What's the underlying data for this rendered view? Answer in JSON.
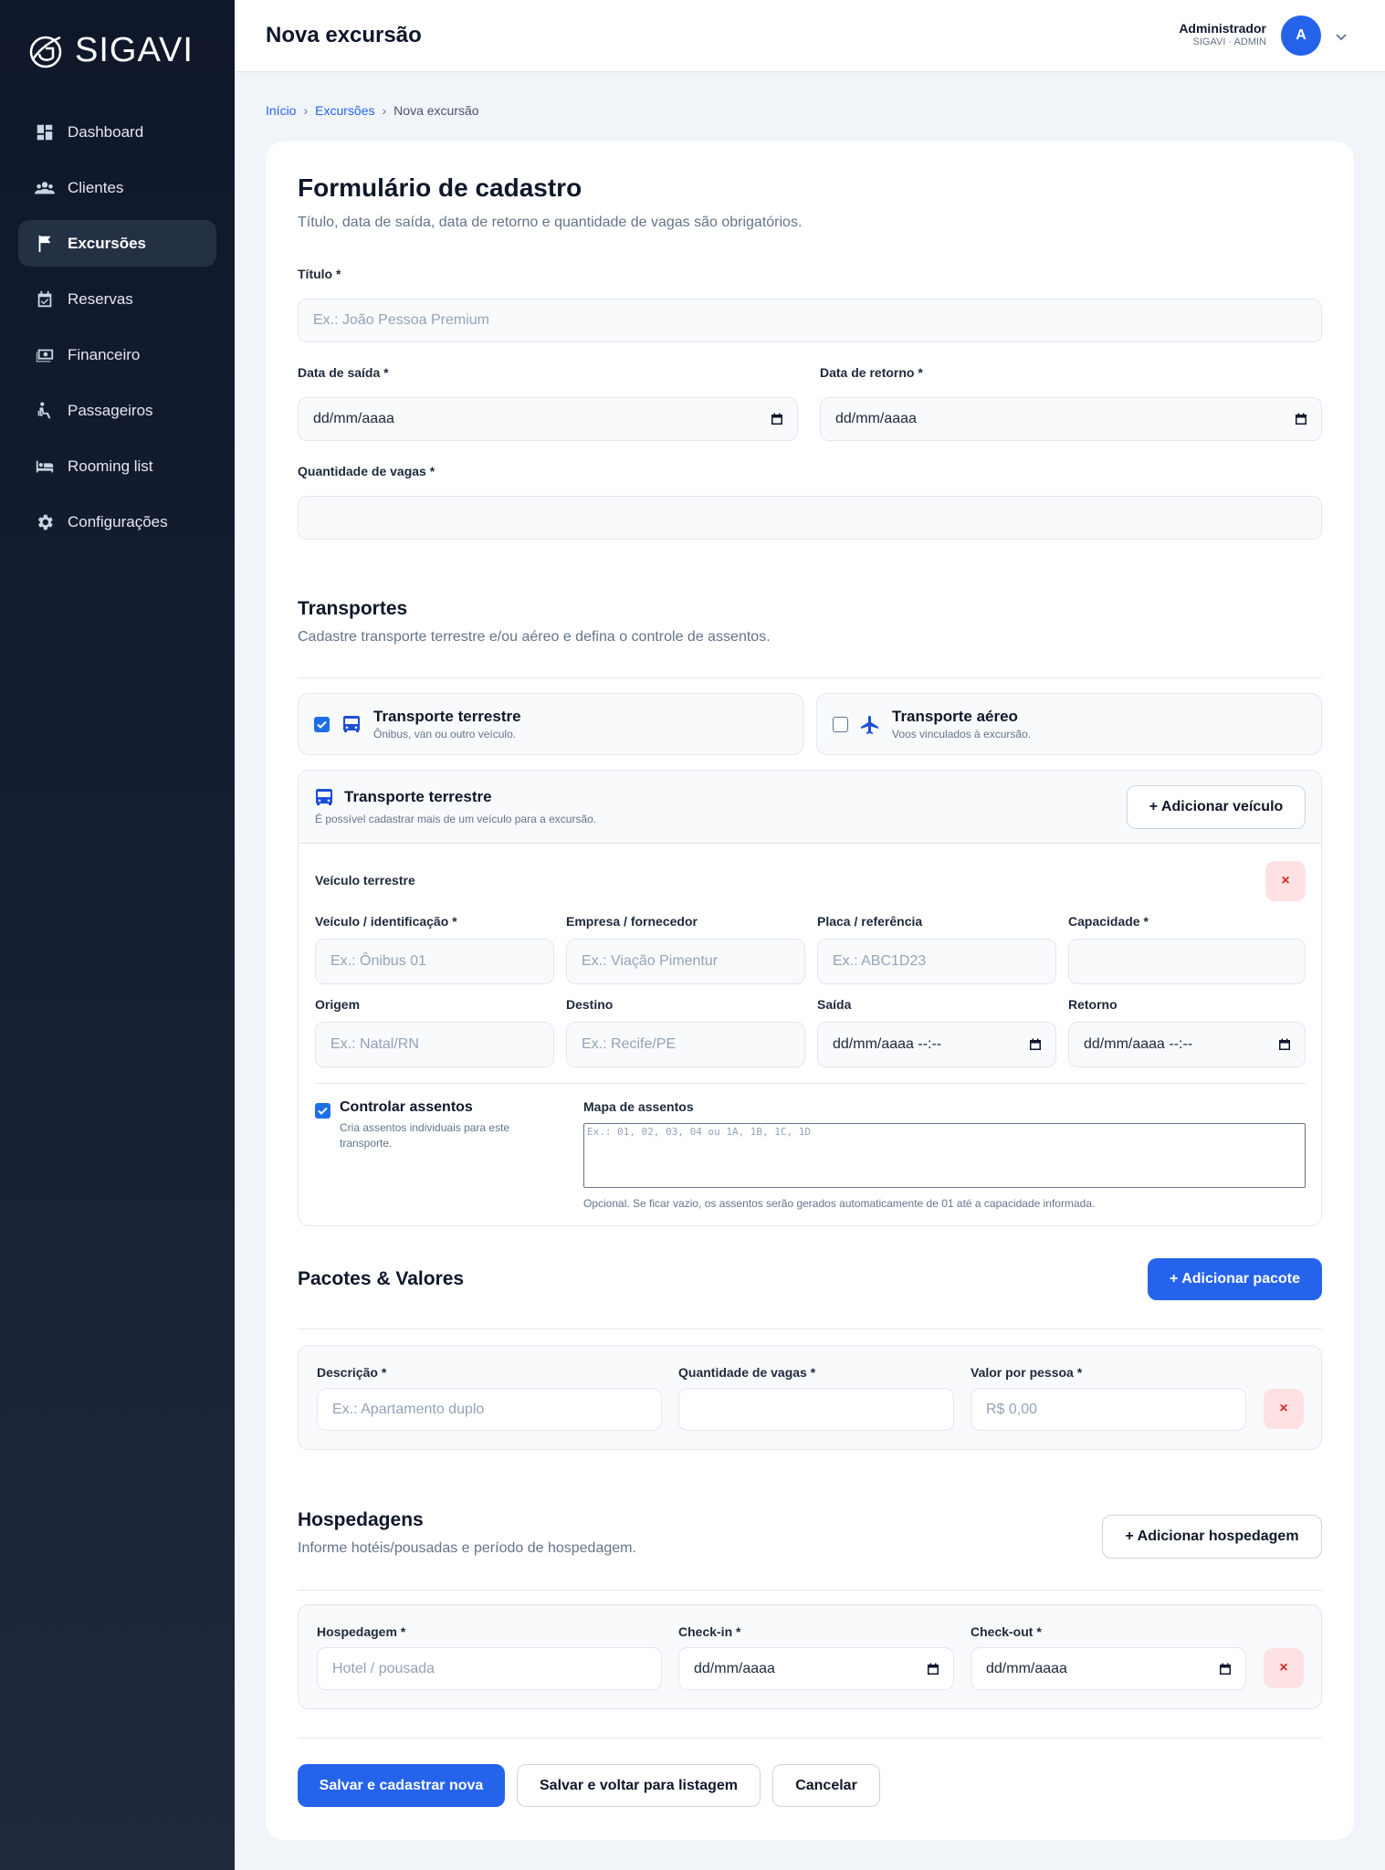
{
  "brand": {
    "name": "SIGAVI"
  },
  "nav": [
    {
      "label": "Dashboard",
      "icon": "dashboard-icon"
    },
    {
      "label": "Clientes",
      "icon": "clients-icon"
    },
    {
      "label": "Excursões",
      "icon": "flag-icon",
      "active": true
    },
    {
      "label": "Reservas",
      "icon": "calendar-check-icon"
    },
    {
      "label": "Financeiro",
      "icon": "money-icon"
    },
    {
      "label": "Passageiros",
      "icon": "passenger-icon"
    },
    {
      "label": "Rooming list",
      "icon": "bed-icon"
    },
    {
      "label": "Configurações",
      "icon": "gear-icon"
    }
  ],
  "topbar": {
    "title": "Nova excursão",
    "user_name": "Administrador",
    "user_role": "SIGAVI · ADMIN",
    "avatar_letter": "A"
  },
  "breadcrumb": {
    "home": "Início",
    "section": "Excursões",
    "current": "Nova excursão"
  },
  "form": {
    "title": "Formulário de cadastro",
    "subtitle": "Título, data de saída, data de retorno e quantidade de vagas são obrigatórios.",
    "titulo_label": "Título *",
    "titulo_placeholder": "Ex.: João Pessoa Premium",
    "saida_label": "Data de saída *",
    "saida_value": "dd/mm/aaaa",
    "retorno_label": "Data de retorno *",
    "retorno_value": "dd/mm/aaaa",
    "vagas_label": "Quantidade de vagas *",
    "vagas_value": ""
  },
  "transportes": {
    "title": "Transportes",
    "subtitle": "Cadastre transporte terrestre e/ou aéreo e defina o controle de assentos.",
    "terrestre_option": {
      "title": "Transporte terrestre",
      "sub": "Ônibus, van ou outro veículo.",
      "checked": true
    },
    "aereo_option": {
      "title": "Transporte aéreo",
      "sub": "Voos vinculados à excursão.",
      "checked": false
    },
    "panel": {
      "title": "Transporte terrestre",
      "sub": "É possível cadastrar mais de um veículo para a excursão.",
      "add_button": "+ Adicionar veículo",
      "vehicle_title": "Veículo terrestre",
      "remove": "×",
      "fields": {
        "veiculo_label": "Veículo / identificação *",
        "veiculo_placeholder": "Ex.: Ônibus 01",
        "empresa_label": "Empresa / fornecedor",
        "empresa_placeholder": "Ex.: Viação Pimentur",
        "placa_label": "Placa / referência",
        "placa_placeholder": "Ex.: ABC1D23",
        "capacidade_label": "Capacidade *",
        "capacidade_value": "",
        "origem_label": "Origem",
        "origem_placeholder": "Ex.: Natal/RN",
        "destino_label": "Destino",
        "destino_placeholder": "Ex.: Recife/PE",
        "saida_label": "Saída",
        "saida_value": "dd/mm/aaaa --:--",
        "retorno_label": "Retorno",
        "retorno_value": "dd/mm/aaaa --:--"
      },
      "controlar": {
        "title": "Controlar assentos",
        "sub": "Cria assentos individuais para este transporte.",
        "checked": true
      },
      "mapa": {
        "label": "Mapa de assentos",
        "placeholder": "Ex.: 01, 02, 03, 04 ou 1A, 1B, 1C, 1D",
        "hint": "Opcional. Se ficar vazio, os assentos serão gerados automaticamente de 01 até a capacidade informada."
      }
    }
  },
  "pacotes": {
    "title": "Pacotes & Valores",
    "add_button": "+ Adicionar pacote",
    "descricao_label": "Descrição *",
    "descricao_placeholder": "Ex.: Apartamento duplo",
    "vagas_label": "Quantidade de vagas *",
    "vagas_value": "",
    "valor_label": "Valor por pessoa *",
    "valor_placeholder": "R$ 0,00",
    "remove": "×"
  },
  "hospedagens": {
    "title": "Hospedagens",
    "subtitle": "Informe hotéis/pousadas e período de hospedagem.",
    "add_button": "+ Adicionar hospedagem",
    "hospedagem_label": "Hospedagem *",
    "hospedagem_placeholder": "Hotel / pousada",
    "checkin_label": "Check-in *",
    "checkin_value": "dd/mm/aaaa",
    "checkout_label": "Check-out *",
    "checkout_value": "dd/mm/aaaa",
    "remove": "×"
  },
  "actions": {
    "save_new": "Salvar e cadastrar nova",
    "save_back": "Salvar e voltar para listagem",
    "cancel": "Cancelar"
  }
}
